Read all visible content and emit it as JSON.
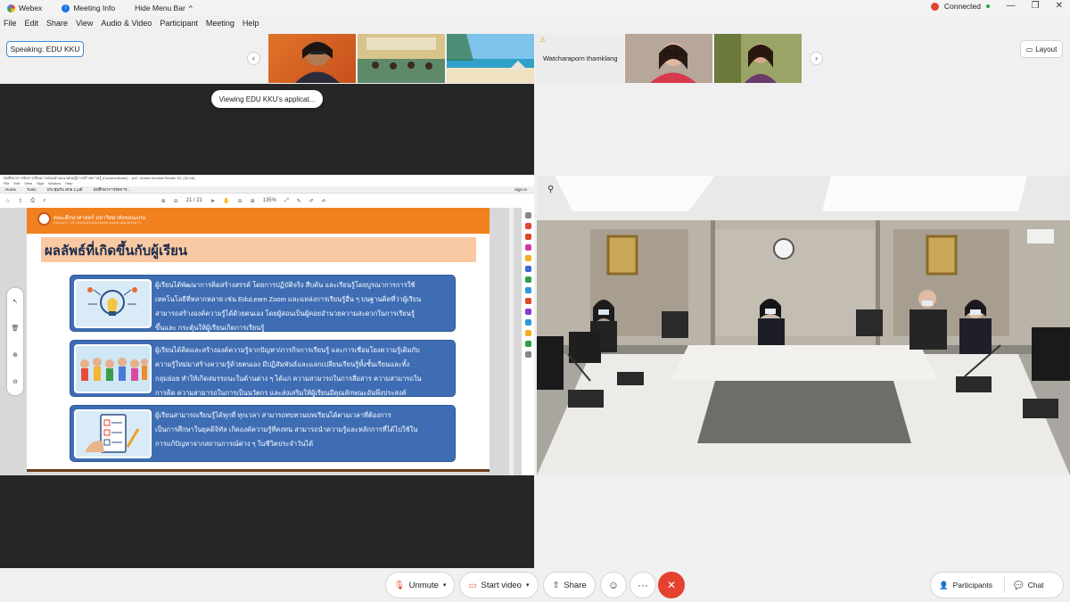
{
  "titlebar": {
    "app_name": "Webex",
    "meeting_info": "Meeting Info",
    "hide_menu": "Hide Menu Bar",
    "hide_menu_chevron": "^",
    "connection": "Connected",
    "win_minimize": "—",
    "win_restore": "❐",
    "win_close": "✕"
  },
  "menu": {
    "items": [
      "File",
      "Edit",
      "Share",
      "View",
      "Audio & Video",
      "Participant",
      "Meeting",
      "Help"
    ]
  },
  "speaking": "Speaking: EDU KKU",
  "thumbnails": {
    "prev_icon": "chevron-left-icon",
    "next_icon": "chevron-right-icon",
    "warning_name": "Watcharaporn thamklang"
  },
  "layout_button": "Layout",
  "share": {
    "viewing_text": "Viewing EDU KKU's applicat..."
  },
  "pdf": {
    "title_text": "นักศึกษาการจัดการเรียนการสอนตามแนวทฤษฎีการสร้างความรู้ (Constructivism) ...pdf - Adobe Acrobat Reader DC (32-bit)",
    "menu": [
      "File",
      "Edit",
      "View",
      "Sign",
      "Window",
      "Help"
    ],
    "tabs": [
      "Home",
      "Tools",
      "ประชุมกับ สกอ 1.pdf",
      "นักศึกษาการจัดการ..."
    ],
    "sign_in": "Sign In",
    "page_info": "21 / 21",
    "zoom": "135%"
  },
  "slide": {
    "university_th": "คณะศึกษาศาสตร์ มหาวิทยาลัยขอนแก่น",
    "university_en": "FACULTY OF EDUCATION KHON KAEN UNIVERSITY",
    "title": "ผลลัพธ์ที่เกิดขึ้นกับผู้เรียน",
    "box1": [
      "ผู้เรียนได้พัฒนาการคิดสร้างสรรค์ โดยการปฏิบัติจริง สืบค้น และเรียนรู้โดยบูรณาการการใช้",
      "เทคโนโลยีที่หลากหลาย เช่น EduLearn Zoom และแหล่งการเรียนรู้อื่น ๆ บนฐานคิดที่ว่าผู้เรียน",
      "สามารถสร้างองค์ความรู้ได้ด้วยตนเอง โดยผู้สอนเป็นผู้คอยอำนวยความสะดวกในการเรียนรู้",
      "ขึ้นและ กระตุ้นให้ผู้เรียนเกิดการเรียนรู้"
    ],
    "box2": [
      "ผู้เรียนได้คิดและสร้างองค์ความรู้จากปัญหา/ภารกิจการเรียนรู้ และการเชื่อมโยงความรู้เดิมกับ",
      "ความรู้ใหม่มาสร้างความรู้ด้วยตนเอง มีปฏิสัมพันธ์และแลกเปลี่ยนเรียนรู้ทั้งชั้นเรียนและทั้ง",
      "กลุ่มย่อย ทำให้เกิดสมรรถนะในด้านต่าง ๆ ได้แก่ ความสามารถในการสื่อสาร ความสามารถใน",
      "การคิด ความสามารถในการเป็นนวัตกร และส่งเสริมให้ผู้เรียนมีคุณลักษณะอันพึงประสงค์"
    ],
    "box3": [
      "ผู้เรียนสามารถเรียนรู้ได้ทุกที่ ทุกเวลา สามารถทบทวนบทเรียนได้ตามเวลาที่ต้องการ",
      "เป็นการศึกษาในยุคดิจิทัล เกิดองค์ความรู้ที่คงทน สามารถนำความรู้และหลักการที่ได้ไปใช้ใน",
      "การแก้ปัญหาจากสถานการณ์ต่าง ๆ ในชีวิตประจำวันได้"
    ]
  },
  "toolbar": {
    "unmute": "Unmute",
    "start_video": "Start video",
    "share": "Share",
    "reactions_icon": "smiley-icon",
    "more": "···",
    "end_icon": "close-icon",
    "participants": "Participants",
    "chat": "Chat"
  },
  "colors": {
    "end_red": "#e4412f",
    "slide_orange": "#f1801e",
    "slide_blue": "#3e6db4",
    "speaking_border": "#3a8ad6"
  }
}
